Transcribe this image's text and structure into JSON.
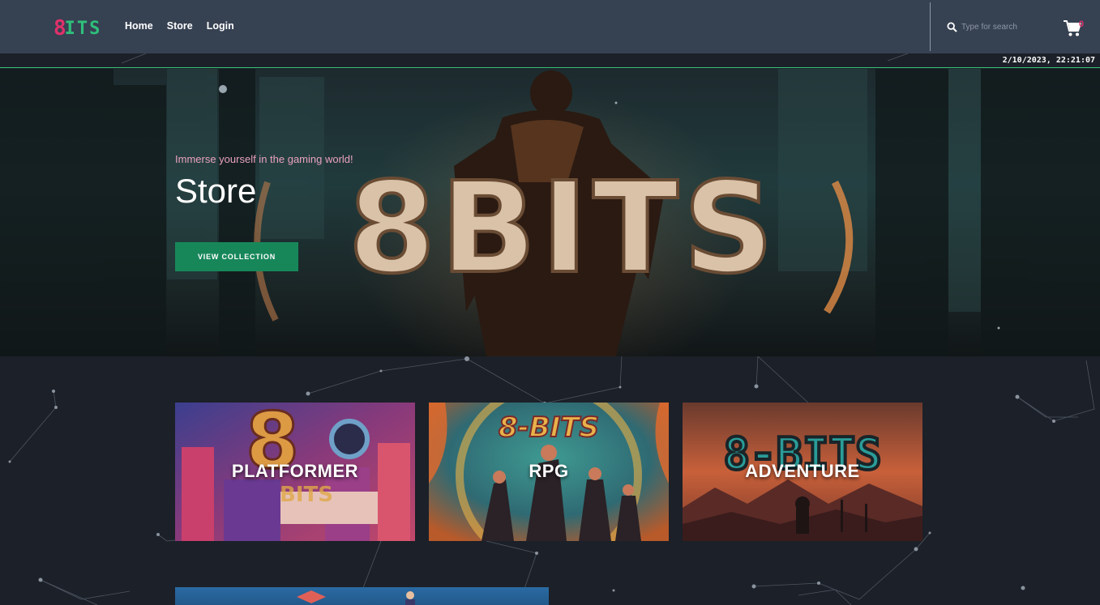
{
  "brand": {
    "logo_eight": "8",
    "logo_bits": "ITS"
  },
  "nav": {
    "home": "Home",
    "store": "Store",
    "login": "Login"
  },
  "search": {
    "placeholder": "Type for search"
  },
  "cart": {
    "count": "0"
  },
  "datetime": "2/10/2023, 22:21:07",
  "hero": {
    "tagline": "Immerse yourself in the gaming world!",
    "title": "Store",
    "button_label": "VIEW COLLECTION",
    "art_text": "8BITS"
  },
  "categories": [
    {
      "label": "PLATFORMER",
      "art_text": "8",
      "art_sub": "BITS"
    },
    {
      "label": "RPG",
      "art_text": "8-BITS"
    },
    {
      "label": "ADVENTURE",
      "art_text": "8-BITS"
    }
  ],
  "colors": {
    "navbar": "#364152",
    "accent_green": "#17875a",
    "accent_pink": "#e0316a",
    "page_bg": "#1c2028"
  }
}
